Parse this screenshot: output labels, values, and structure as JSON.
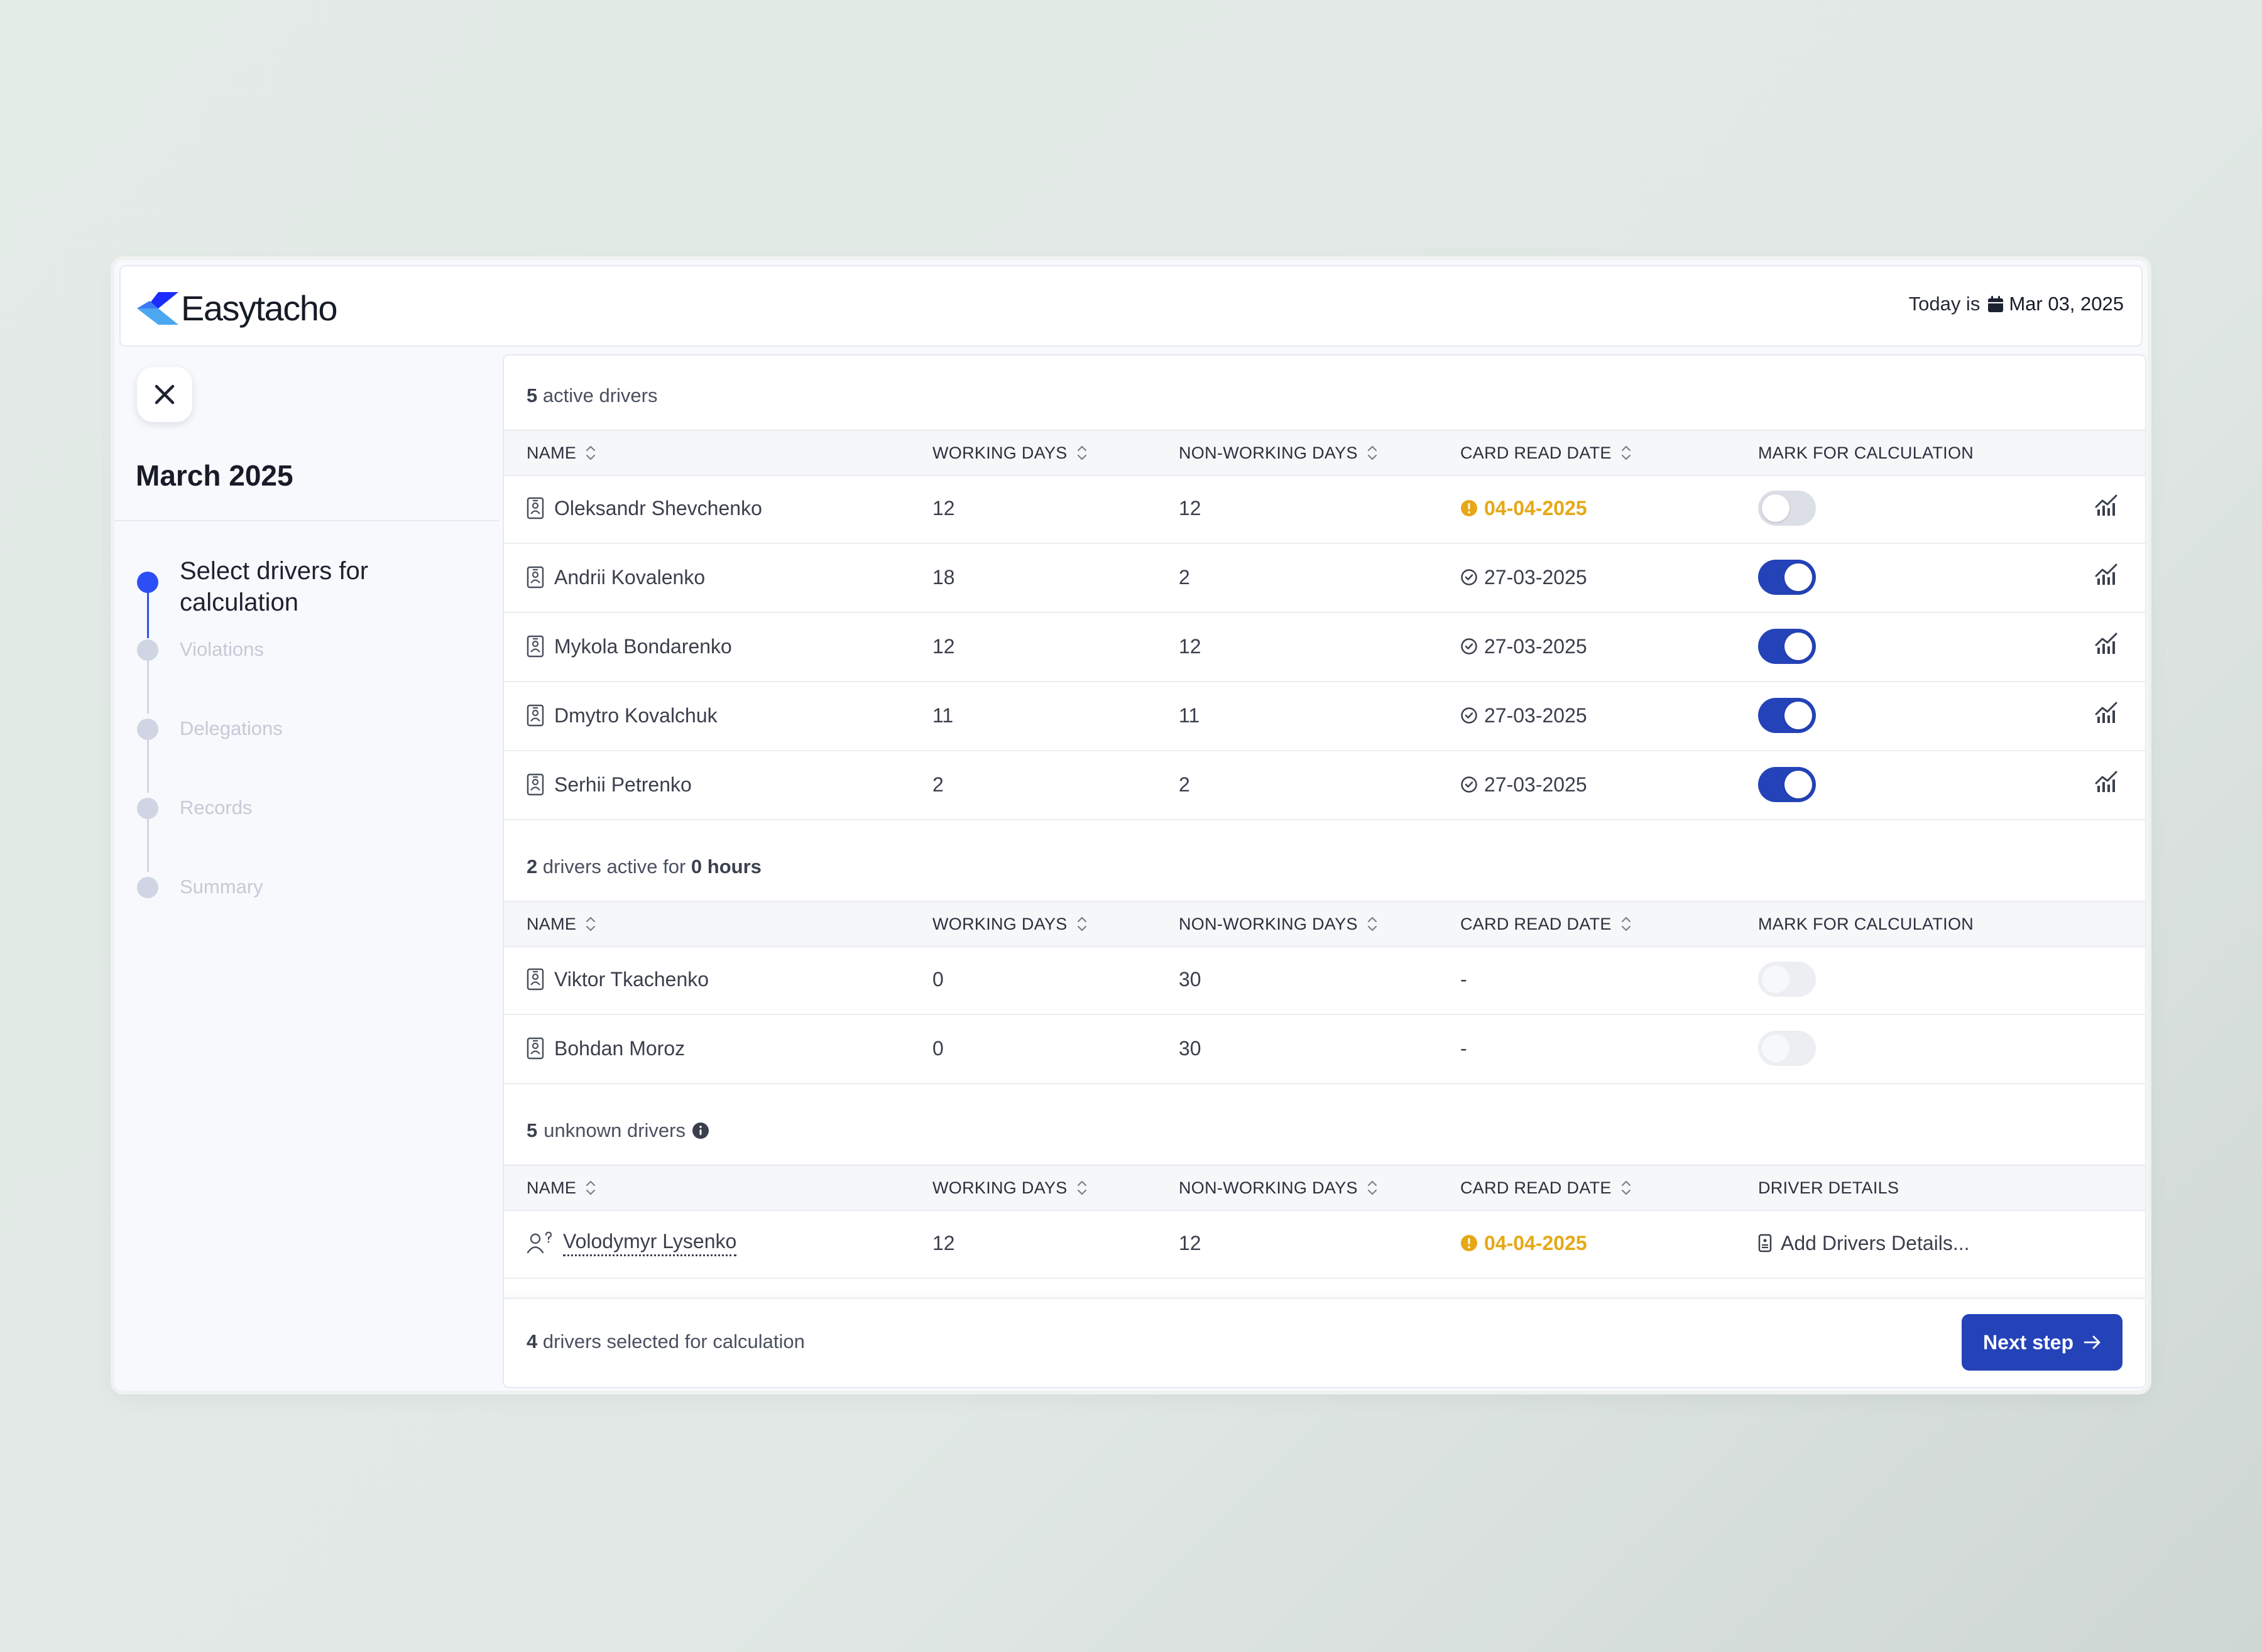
{
  "brand": {
    "name": "Easytacho"
  },
  "header": {
    "today_label": "Today is",
    "today_date": "Mar 03, 2025"
  },
  "sidebar": {
    "month": "March 2025",
    "steps": [
      {
        "label": "Select drivers for calculation",
        "active": true
      },
      {
        "label": "Violations",
        "active": false
      },
      {
        "label": "Delegations",
        "active": false
      },
      {
        "label": "Records",
        "active": false
      },
      {
        "label": "Summary",
        "active": false
      }
    ]
  },
  "sections": {
    "active": {
      "count": "5",
      "title_suffix": "active drivers",
      "columns": [
        "NAME",
        "WORKING DAYS",
        "NON-WORKING DAYS",
        "CARD READ DATE",
        "MARK FOR CALCULATION"
      ],
      "rows": [
        {
          "name": "Oleksandr Shevchenko",
          "working": "12",
          "non_working": "12",
          "card_date": "04-04-2025",
          "warn": true,
          "marked": false
        },
        {
          "name": "Andrii Kovalenko",
          "working": "18",
          "non_working": "2",
          "card_date": "27-03-2025",
          "warn": false,
          "marked": true
        },
        {
          "name": "Mykola Bondarenko",
          "working": "12",
          "non_working": "12",
          "card_date": "27-03-2025",
          "warn": false,
          "marked": true
        },
        {
          "name": "Dmytro Kovalchuk",
          "working": "11",
          "non_working": "11",
          "card_date": "27-03-2025",
          "warn": false,
          "marked": true
        },
        {
          "name": "Serhii Petrenko",
          "working": "2",
          "non_working": "2",
          "card_date": "27-03-2025",
          "warn": false,
          "marked": true
        }
      ]
    },
    "zero": {
      "count": "2",
      "title_mid": "drivers active for",
      "hours": "0 hours",
      "columns": [
        "NAME",
        "WORKING DAYS",
        "NON-WORKING DAYS",
        "CARD READ DATE",
        "MARK FOR CALCULATION"
      ],
      "rows": [
        {
          "name": "Viktor Tkachenko",
          "working": "0",
          "non_working": "30",
          "card_date": "-"
        },
        {
          "name": "Bohdan Moroz",
          "working": "0",
          "non_working": "30",
          "card_date": "-"
        }
      ]
    },
    "unknown": {
      "count": "5",
      "title_suffix": "unknown drivers",
      "columns": [
        "NAME",
        "WORKING DAYS",
        "NON-WORKING DAYS",
        "CARD READ DATE",
        "DRIVER DETAILS"
      ],
      "rows": [
        {
          "name": "Volodymyr Lysenko",
          "working": "12",
          "non_working": "12",
          "card_date": "04-04-2025",
          "details": "Add Drivers Details..."
        }
      ]
    }
  },
  "footer": {
    "count": "4",
    "text": "drivers selected for calculation",
    "next_label": "Next step"
  },
  "colors": {
    "accent": "#2443b8",
    "active_step": "#2c4ff5",
    "warning": "#e6a817"
  }
}
